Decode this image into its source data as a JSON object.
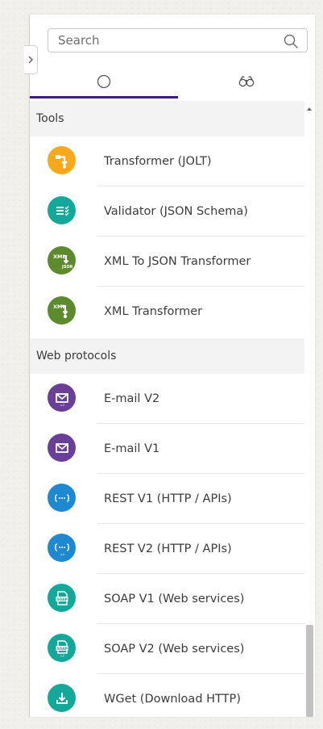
{
  "search": {
    "placeholder": "Search",
    "value": ""
  },
  "tabs": [
    {
      "icon": "circle-outline-icon",
      "active": true
    },
    {
      "icon": "binoculars-icon",
      "active": false
    }
  ],
  "colors": {
    "tab_underline": "#3e1c7d",
    "orange": "#f7a81c",
    "teal": "#14a89a",
    "green": "#5d8a2c",
    "purple": "#6a3f98",
    "blue": "#1e88d0"
  },
  "sections": [
    {
      "title": "Tools",
      "items": [
        {
          "label": "Transformer (JOLT)",
          "icon": "transformer-icon",
          "color": "#f7a81c"
        },
        {
          "label": "Validator (JSON Schema)",
          "icon": "checklist-icon",
          "color": "#14a89a"
        },
        {
          "label": "XML To JSON Transformer",
          "icon": "xml-to-json-icon",
          "color": "#5d8a2c"
        },
        {
          "label": "XML Transformer",
          "icon": "xml-transformer-icon",
          "color": "#5d8a2c"
        }
      ]
    },
    {
      "title": "Web protocols",
      "items": [
        {
          "label": "E-mail V2",
          "icon": "envelope-icon",
          "color": "#6a3f98"
        },
        {
          "label": "E-mail V1",
          "icon": "envelope-icon",
          "color": "#6a3f98"
        },
        {
          "label": "REST V1 (HTTP / APIs)",
          "icon": "rest-api-icon",
          "color": "#1e88d0"
        },
        {
          "label": "REST V2 (HTTP / APIs)",
          "icon": "rest-api-icon",
          "color": "#1e88d0"
        },
        {
          "label": "SOAP V1 (Web services)",
          "icon": "soap-icon",
          "color": "#14a89a"
        },
        {
          "label": "SOAP V2 (Web services)",
          "icon": "soap-icon",
          "color": "#14a89a"
        },
        {
          "label": "WGet (Download HTTP)",
          "icon": "download-icon",
          "color": "#14a89a"
        }
      ]
    }
  ]
}
